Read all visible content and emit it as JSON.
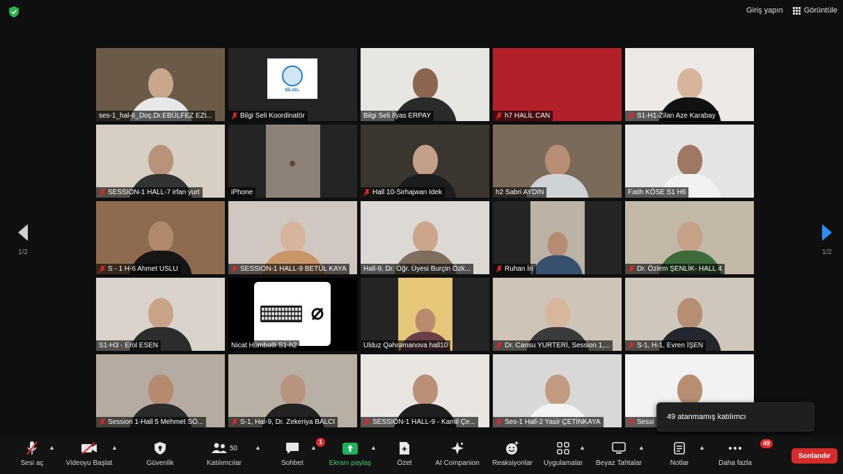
{
  "top": {
    "sign_in": "Giriş yapın",
    "view": "Görüntüle"
  },
  "nav": {
    "left_page": "1/2",
    "right_page": "1/2"
  },
  "tiles": [
    {
      "name": "ses-1_hal-6_Doç.Dr.EBÜLFEZ EZİ...",
      "muted": false,
      "bg": "#6b5a48",
      "skin": "#c9a58c",
      "shirt": "#e8e8e8"
    },
    {
      "name": "Bilgi Seli Koordinatör",
      "muted": true,
      "logo": "BİLSEL"
    },
    {
      "name": "Bilgi Seli İlyas ERPAY",
      "muted": false,
      "active": true,
      "bg": "#e8e6e2",
      "skin": "#8c6650",
      "shirt": "#2a2a2a"
    },
    {
      "name": "h7 HALİL CAN",
      "muted": true,
      "solid": "#b3202a"
    },
    {
      "name": "S1-H1-Zilan Aze Karabay",
      "muted": true,
      "bg": "#ece9e6",
      "skin": "#d8b49c",
      "shirt": "#111"
    },
    {
      "name": "SESSION-1 HALL-7 irfan yurt",
      "muted": true,
      "bg": "#d7cfc4",
      "skin": "#b8927a",
      "shirt": "#333"
    },
    {
      "name": "iPhone",
      "muted": false,
      "inset": "#8c8278"
    },
    {
      "name": "Hall 10-Sirhajwan Idek",
      "muted": true,
      "bg": "#3b3530",
      "skin": "#c4a08a",
      "shirt": "#1c1c1c"
    },
    {
      "name": "h2 Sabri AYDIN",
      "muted": false,
      "bg": "#7a6a5a",
      "skin": "#b78e74",
      "shirt": "#cfd3d6"
    },
    {
      "name": "Fatih KÖSE S1 H6",
      "muted": false,
      "bg": "#e4e4e4",
      "skin": "#9e7862",
      "shirt": "#f2f2f2"
    },
    {
      "name": "S - 1 H-6 Ahmet USLU",
      "muted": true,
      "bg": "#8e6b4e",
      "skin": "#b18a6e",
      "shirt": "#161616"
    },
    {
      "name": "SESSION-1 HALL-9 BETÜL KAYA",
      "muted": true,
      "bg": "#d0c8c0",
      "skin": "#d7b59c",
      "shirt": "#c9956a"
    },
    {
      "name": "Hall-9, Dr. Öğr. Üyesi Burçin Özk...",
      "muted": false,
      "bg": "#dcd8d4",
      "skin": "#cba58c",
      "shirt": "#7d6e60"
    },
    {
      "name": "Ruhan İri",
      "muted": true,
      "inset": "#bcb2a6",
      "skin": "#b58c72",
      "shirt": "#37506e"
    },
    {
      "name": "Dr. Özlem ŞENLİK- HALL 4",
      "muted": true,
      "bg": "#c2b8a8",
      "skin": "#c7a088",
      "shirt": "#3c6a3a"
    },
    {
      "name": "S1-H3 - Erol ESEN",
      "muted": false,
      "bg": "#d9d3cc",
      "skin": "#caa288",
      "shirt": "#2c2c2c"
    },
    {
      "name": "Nicat Hümbətli S1-h2",
      "muted": false,
      "keyboard": true
    },
    {
      "name": "Ulduz Qəhrəmanova hall10",
      "muted": false,
      "inset": "#e6c77a",
      "skin": "#b98a6c",
      "shirt": "#6a3f48"
    },
    {
      "name": "Dr. Cansu YURTERİ, Session 1,...",
      "muted": true,
      "bg": "#cfc4b8",
      "skin": "#d8b69e",
      "shirt": "#3a3a3a"
    },
    {
      "name": "S-1, H-1, Evren İŞEN",
      "muted": true,
      "bg": "#cfc6bc",
      "skin": "#b68e74",
      "shirt": "#23262c"
    },
    {
      "name": "Session 1-Hall 5 Mehmet SÖ...",
      "muted": true,
      "bg": "#b5aba0",
      "skin": "#b58a6e",
      "shirt": "#2b2b2b"
    },
    {
      "name": "S-1, Hal-9, Dr. Zekeriya BALCI",
      "muted": true,
      "bg": "#b8b0a4",
      "skin": "#b89480",
      "shirt": "#222"
    },
    {
      "name": "SESSION-1 HALL-9 - Kamil Çe...",
      "muted": true,
      "bg": "#e9e6e2",
      "skin": "#ba9078",
      "shirt": "#1f1f1f"
    },
    {
      "name": "Ses-1 Hall-2 Yasir ÇETİNKAYA",
      "muted": true,
      "bg": "#d8d8d6",
      "skin": "#c29a80",
      "shirt": "#f3f3f3"
    },
    {
      "name": "Sessi",
      "muted": true,
      "bg": "#f2f2f2",
      "skin": "#b88e72",
      "shirt": "#222"
    }
  ],
  "tooltip": {
    "text": "49 atanmamış katılımcı"
  },
  "toolbar": {
    "audio": "Sesi aç",
    "video": "Videoyu Başlat",
    "security": "Güvenlik",
    "participants": "Katılımcılar",
    "participants_count": "50",
    "chat": "Sohbet",
    "chat_badge": "1",
    "share": "Ekranı paylaş",
    "summary": "Özet",
    "ai": "AI Companion",
    "reactions": "Reaksiyonlar",
    "apps": "Uygulamalar",
    "whiteboard": "Beyaz Tahtalar",
    "notes": "Notlar",
    "more": "Daha fazla",
    "more_badge": "49",
    "end": "Sonlandır"
  },
  "colors": {
    "active_border": "#c9e13a",
    "share_green": "#1fb25a",
    "end_red": "#d62c2c",
    "badge_red": "#e02828"
  }
}
